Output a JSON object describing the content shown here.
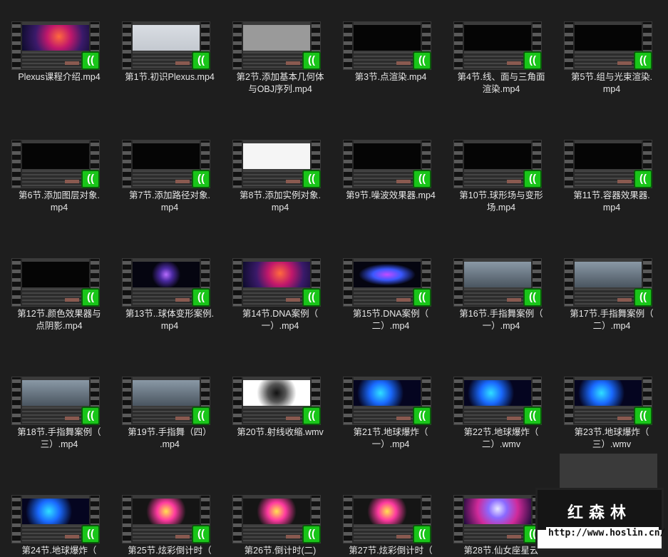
{
  "files": [
    {
      "name": "Plexus课程介绍.mp4",
      "thumb": "nebula"
    },
    {
      "name": "第1节.初识Plexus.mp4",
      "thumb": "window"
    },
    {
      "name": "第2节.添加基本几何体\n与OBJ序列.mp4",
      "thumb": "grey"
    },
    {
      "name": "第3节.点渲染.mp4",
      "thumb": "black"
    },
    {
      "name": "第4节.线、面与三角面\n渲染.mp4",
      "thumb": "black"
    },
    {
      "name": "第5节.组与光束渲染.\nmp4",
      "thumb": "black"
    },
    {
      "name": "第6节.添加图层对象.\nmp4",
      "thumb": "black"
    },
    {
      "name": "第7节.添加路径对象.\nmp4",
      "thumb": "shape"
    },
    {
      "name": "第8节.添加实例对象.\nmp4",
      "thumb": "white"
    },
    {
      "name": "第9节.噪波效果器.mp4",
      "thumb": "black"
    },
    {
      "name": "第10节.球形场与变形\n场.mp4",
      "thumb": "black"
    },
    {
      "name": "第11节.容器效果器.\nmp4",
      "thumb": "black"
    },
    {
      "name": "第12节.颜色效果器与\n点阴影.mp4",
      "thumb": "black"
    },
    {
      "name": "第13节..球体变形案例.\nmp4",
      "thumb": "sphere"
    },
    {
      "name": "第14节.DNA案例（\n一）.mp4",
      "thumb": "nebula"
    },
    {
      "name": "第15节.DNA案例（\n二）.mp4",
      "thumb": "dna"
    },
    {
      "name": "第16节.手指舞案例（\n一）.mp4",
      "thumb": "person"
    },
    {
      "name": "第17节.手指舞案例（\n二）.mp4",
      "thumb": "person"
    },
    {
      "name": "第18节.手指舞案例（\n三）.mp4",
      "thumb": "person"
    },
    {
      "name": "第19节.手指舞（四）\n.mp4",
      "thumb": "person"
    },
    {
      "name": "第20节.射线收缩.wmv",
      "thumb": "burst"
    },
    {
      "name": "第21节.地球爆炸（\n一）.mp4",
      "thumb": "earth"
    },
    {
      "name": "第22节.地球爆炸（\n二）.wmv",
      "thumb": "earth"
    },
    {
      "name": "第23节.地球爆炸（\n三）.wmv",
      "thumb": "earth"
    },
    {
      "name": "第24节.地球爆炸（",
      "thumb": "earth"
    },
    {
      "name": "第25节.炫彩倒计时（",
      "thumb": "three"
    },
    {
      "name": "第26节.倒计时(二)",
      "thumb": "three"
    },
    {
      "name": "第27节.炫彩倒计时（",
      "thumb": "three"
    },
    {
      "name": "第28节.仙女座星云",
      "thumb": "nebula2"
    }
  ],
  "badge_icon": "video-play-icon",
  "watermark": {
    "title": "红森林",
    "url": "http://www.hoslin.cn/"
  }
}
